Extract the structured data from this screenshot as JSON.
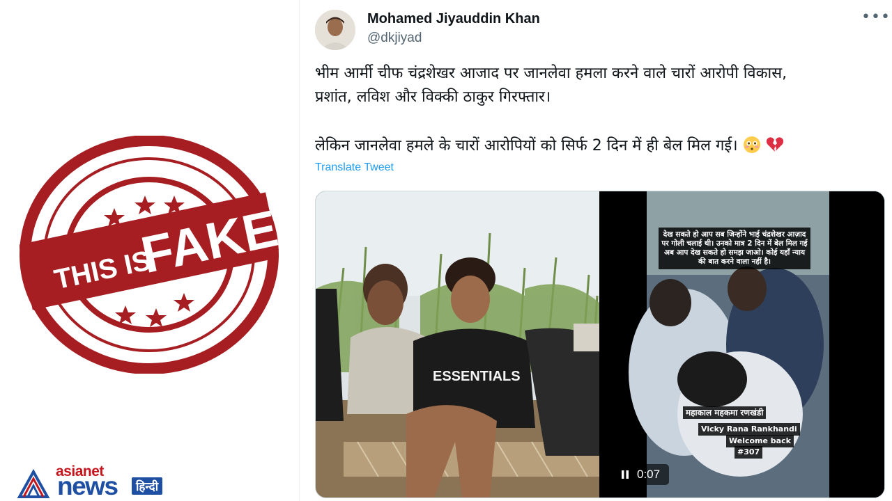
{
  "stamp": {
    "line1": "THIS IS",
    "line2": "FAKE"
  },
  "brand": {
    "asianet": "asianet",
    "news": "news",
    "hindi": "हिन्दी"
  },
  "tweet": {
    "display_name": "Mohamed Jiyauddin Khan",
    "handle": "@dkjiyad",
    "more_icon": "more-dots-icon",
    "line1": "भीम आर्मी चीफ चंद्रशेखर आजाद पर जानलेवा हमला करने वाले चारों आरोपी विकास,",
    "line2": "प्रशांत, लविश और विक्की ठाकुर गिरफ्तार।",
    "line3": "लेकिन जानलेवा हमले के चारों आरोपियों को सिर्फ 2 दिन में ही बेल मिल गई।",
    "translate": "Translate Tweet"
  },
  "media": {
    "photo_shirt_text": "ESSENTIALS",
    "video_caption": "देख सकते हो आप सब जिन्होंने भाई चंद्रशेखर आज़ाद पर गोली चलाई थी। उनको मात्र 2 दिन में बेल मिल गई अब आप देख सकते हो समझ जाओ। कोई यहाँ न्याय की बात करने वाला नहीं है।",
    "tag1": "महाकाल महकमा रणखंडी",
    "tag2": "Vicky Rana Rankhandi",
    "tag3": "Welcome back",
    "tag4": "#307",
    "duration": "0:07"
  },
  "colors": {
    "stamp": "#a61e22",
    "brand_red": "#c4161c",
    "brand_blue": "#1f4fa3",
    "link": "#1d9bf0"
  }
}
